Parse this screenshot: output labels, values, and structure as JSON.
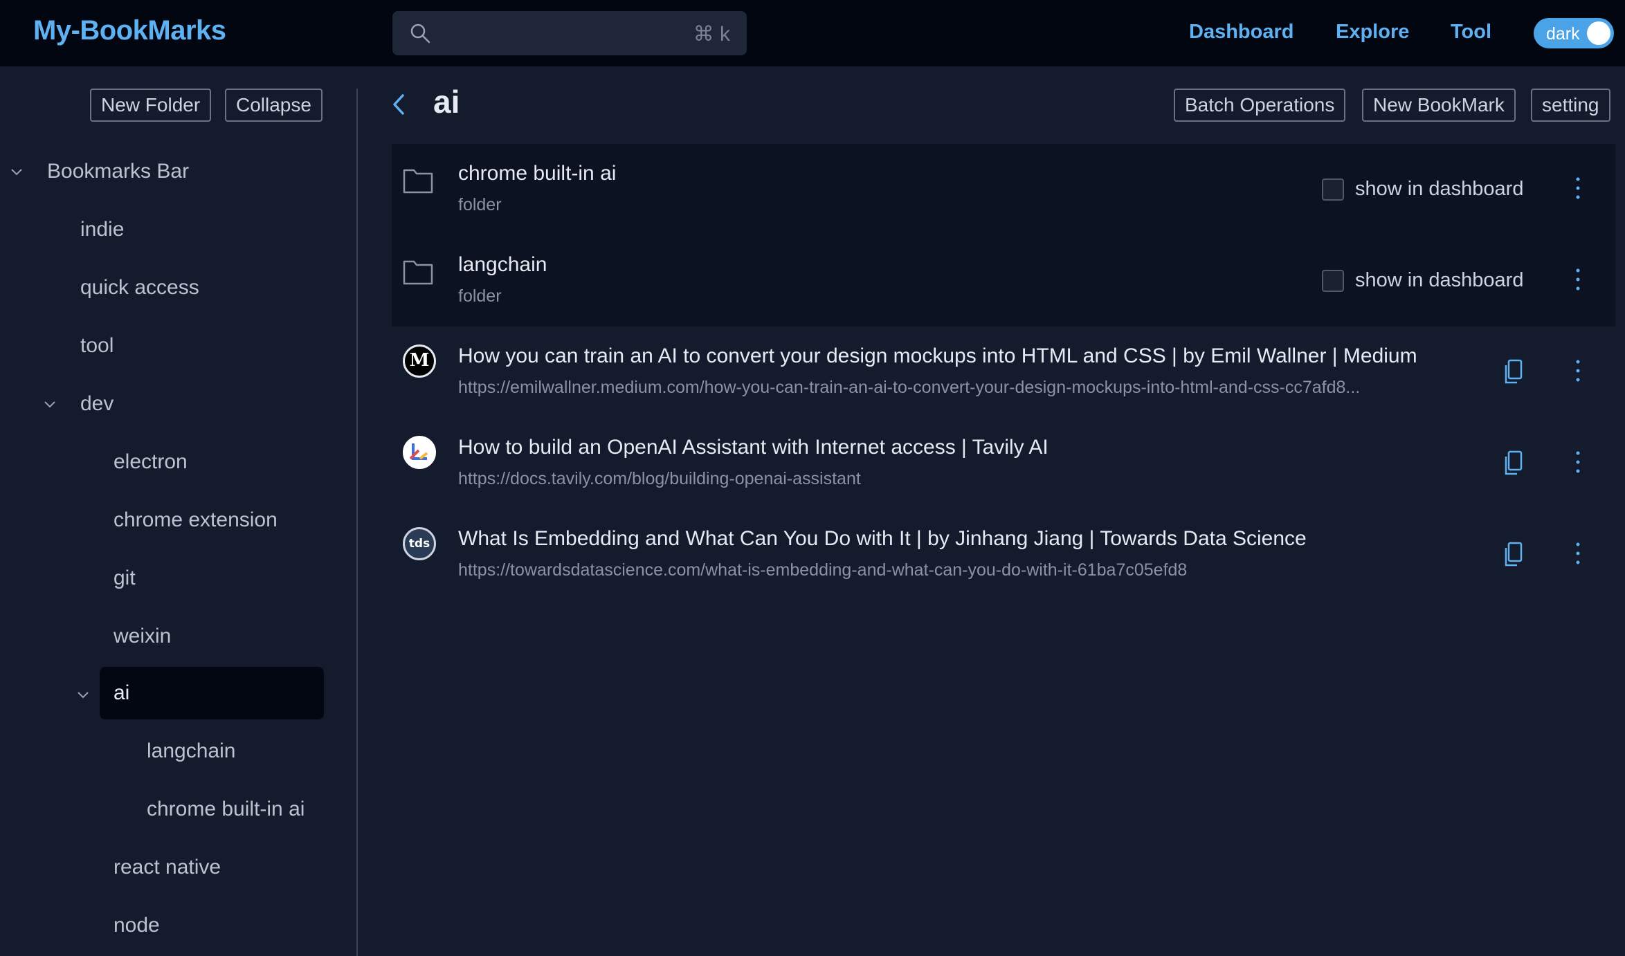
{
  "app": {
    "logo": "My-BookMarks",
    "search_shortcut": "⌘ k",
    "nav": [
      "Dashboard",
      "Explore",
      "Tool"
    ],
    "theme_toggle_label": "dark",
    "accent_color": "#5fb2f2"
  },
  "sidebar": {
    "new_folder_label": "New Folder",
    "collapse_label": "Collapse",
    "tree": [
      {
        "label": "Bookmarks Bar",
        "expanded": true
      },
      {
        "label": "indie"
      },
      {
        "label": "quick access"
      },
      {
        "label": "tool"
      },
      {
        "label": "dev",
        "expanded": true
      },
      {
        "label": "electron"
      },
      {
        "label": "chrome extension"
      },
      {
        "label": "git"
      },
      {
        "label": "weixin"
      },
      {
        "label": "ai",
        "expanded": true,
        "selected": true
      },
      {
        "label": "langchain"
      },
      {
        "label": "chrome built-in ai"
      },
      {
        "label": "react native"
      },
      {
        "label": "node"
      }
    ]
  },
  "main": {
    "title": "ai",
    "batch_label": "Batch Operations",
    "new_bookmark_label": "New BookMark",
    "setting_label": "setting",
    "folders": [
      {
        "name": "chrome built-in ai",
        "type": "folder",
        "show_label": "show in dashboard"
      },
      {
        "name": "langchain",
        "type": "folder",
        "show_label": "show in dashboard"
      }
    ],
    "bookmarks": [
      {
        "title": "How you can train an AI to convert your design mockups into HTML and CSS | by Emil Wallner | Medium",
        "url": "https://emilwallner.medium.com/how-you-can-train-an-ai-to-convert-your-design-mockups-into-html-and-css-cc7afd8...",
        "favicon": "medium-icon"
      },
      {
        "title": "How to build an OpenAI Assistant with Internet access | Tavily AI",
        "url": "https://docs.tavily.com/blog/building-openai-assistant",
        "favicon": "tavily-icon"
      },
      {
        "title": "What Is Embedding and What Can You Do with It | by Jinhang Jiang | Towards Data Science",
        "url": "https://towardsdatascience.com/what-is-embedding-and-what-can-you-do-with-it-61ba7c05efd8",
        "favicon": "tds-icon"
      }
    ],
    "favicon_text": {
      "medium": "M",
      "tds": "tds"
    }
  }
}
